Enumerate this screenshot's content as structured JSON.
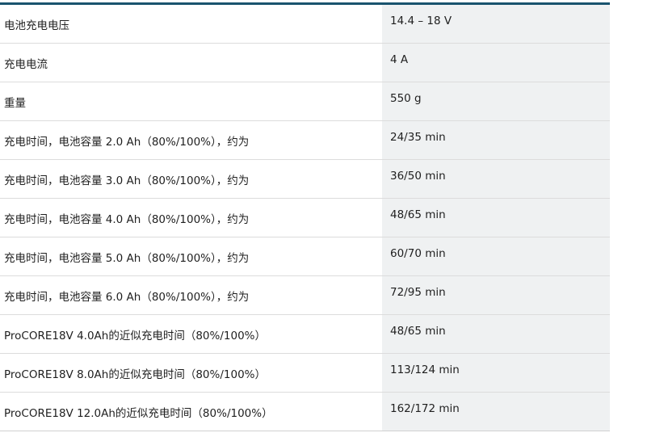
{
  "spec_table": {
    "rows": [
      {
        "label": "电池充电电压",
        "value": "14.4 – 18 V"
      },
      {
        "label": "充电电流",
        "value": "4 A"
      },
      {
        "label": "重量",
        "value": "550 g"
      },
      {
        "label": "充电时间，电池容量 2.0 Ah（80%/100%），约为",
        "value": "24/35 min"
      },
      {
        "label": "充电时间，电池容量 3.0 Ah（80%/100%），约为",
        "value": "36/50 min"
      },
      {
        "label": "充电时间，电池容量 4.0 Ah（80%/100%），约为",
        "value": "48/65 min"
      },
      {
        "label": "充电时间，电池容量 5.0 Ah（80%/100%），约为",
        "value": "60/70 min"
      },
      {
        "label": "充电时间，电池容量 6.0 Ah（80%/100%），约为",
        "value": "72/95 min"
      },
      {
        "label": "ProCORE18V 4.0Ah的近似充电时间（80%/100%）",
        "value": "48/65 min"
      },
      {
        "label": "ProCORE18V 8.0Ah的近似充电时间（80%/100%）",
        "value": "113/124 min"
      },
      {
        "label": "ProCORE18V 12.0Ah的近似充电时间（80%/100%）",
        "value": "162/172 min"
      }
    ]
  },
  "colors": {
    "header_rule": "#19536e",
    "value_column_bg": "#eff1f2",
    "row_divider": "#dcdcdc"
  }
}
